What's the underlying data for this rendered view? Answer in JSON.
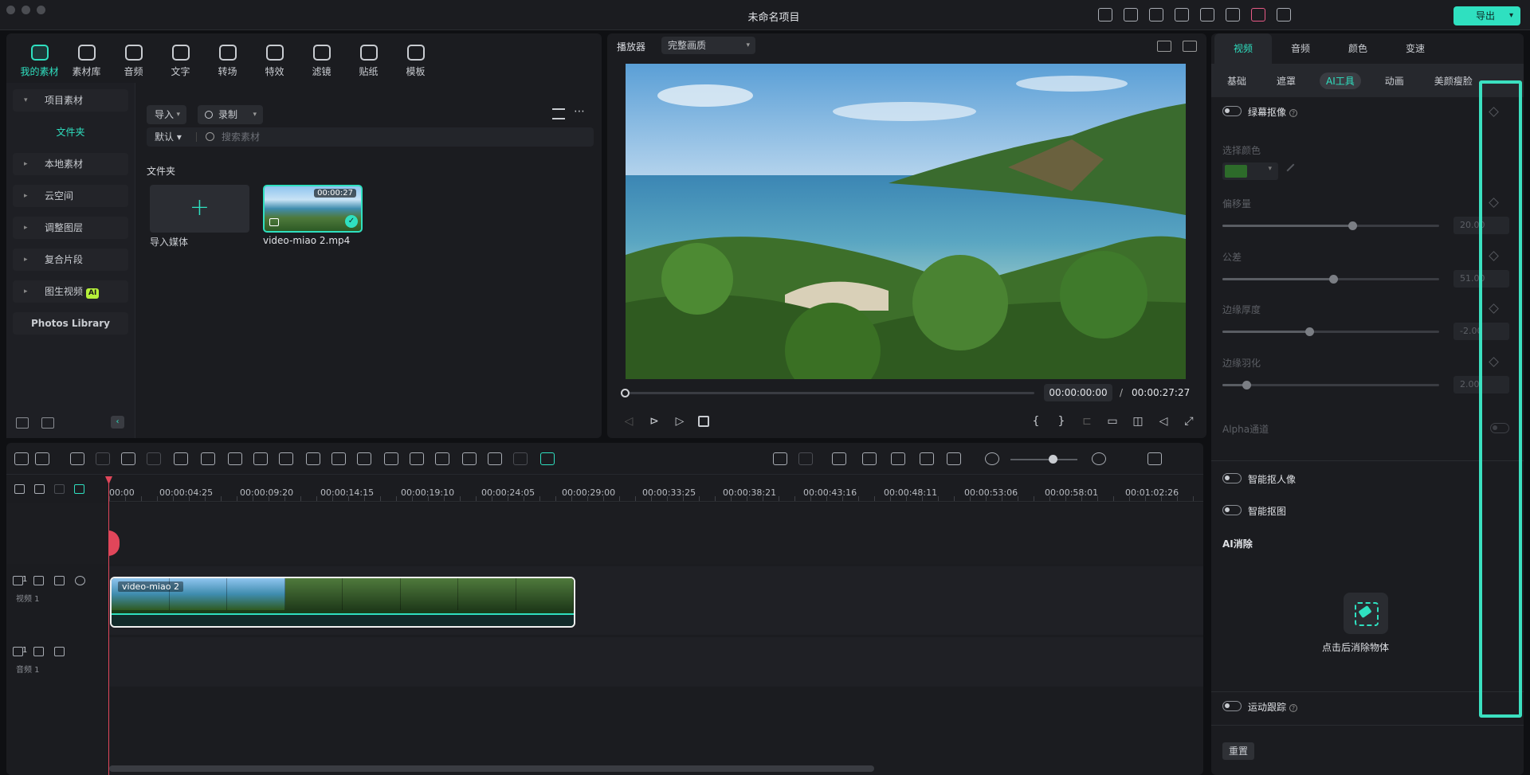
{
  "titlebar": {
    "title": "未命名项目",
    "export_label": "导出"
  },
  "media": {
    "tools": [
      {
        "label": "我的素材",
        "icon": "my-media-icon",
        "active": true
      },
      {
        "label": "素材库",
        "icon": "stock-library-icon"
      },
      {
        "label": "音频",
        "icon": "music-icon"
      },
      {
        "label": "文字",
        "icon": "text-icon"
      },
      {
        "label": "转场",
        "icon": "transition-icon"
      },
      {
        "label": "特效",
        "icon": "effects-icon"
      },
      {
        "label": "滤镜",
        "icon": "filter-icon"
      },
      {
        "label": "贴纸",
        "icon": "sticker-icon"
      },
      {
        "label": "模板",
        "icon": "template-icon"
      }
    ],
    "sidebar": {
      "project_media": "项目素材",
      "folder": "文件夹",
      "local_media": "本地素材",
      "cloud": "云空间",
      "adjustment": "调整图层",
      "compound": "复合片段",
      "image_to_video": "图生视频",
      "ai_badge": "AI",
      "photos_library": "Photos Library"
    },
    "import_label": "导入",
    "record_label": "录制",
    "sort_label": "默认",
    "search_placeholder": "搜索素材",
    "folder_title": "文件夹",
    "import_tile_label": "导入媒体",
    "clip": {
      "name": "video-miao 2.mp4",
      "duration": "00:00:27"
    }
  },
  "player": {
    "label": "播放器",
    "quality": "完整画质",
    "current_time": "00:00:00:00",
    "separator": "/",
    "total_time": "00:00:27:27"
  },
  "inspector": {
    "main_tabs": [
      "视频",
      "音频",
      "颜色",
      "变速"
    ],
    "active_main_tab": "视频",
    "sub_tabs": [
      "基础",
      "遮罩",
      "AI工具",
      "动画",
      "美颜瘦脸"
    ],
    "active_sub_tab": "AI工具",
    "chroma_key": "绿幕抠像",
    "select_color": "选择颜色",
    "color_hex": "#2d6b2a",
    "sliders": [
      {
        "label": "偏移量",
        "value": "20.00",
        "fraction": 0.6
      },
      {
        "label": "公差",
        "value": "51.00",
        "fraction": 0.51
      },
      {
        "label": "边缘厚度",
        "value": "-2.00",
        "fraction": 0.4
      },
      {
        "label": "边缘羽化",
        "value": "2.00",
        "fraction": 0.11
      }
    ],
    "alpha_channel": "Alpha通道",
    "smart_cutout_portrait": "智能抠人像",
    "smart_cutout": "智能抠图",
    "ai_erase_title": "AI消除",
    "ai_erase_action": "点击后消除物体",
    "motion_tracking": "运动跟踪",
    "reset": "重置"
  },
  "timeline": {
    "ruler": [
      "00:00",
      "00:00:04:25",
      "00:00:09:20",
      "00:00:14:15",
      "00:00:19:10",
      "00:00:24:05",
      "00:00:29:00",
      "00:00:33:25",
      "00:00:38:21",
      "00:00:43:16",
      "00:00:48:11",
      "00:00:53:06",
      "00:00:58:01",
      "00:01:02:26"
    ],
    "video_track_num": "1",
    "video_track_label": "视频 1",
    "audio_track_num": "1",
    "audio_track_label": "音频 1",
    "clip_name": "video-miao 2"
  },
  "colors": {
    "accent": "#2fe0c0",
    "playhead": "#e0465a",
    "highlight": "#3be0c0"
  }
}
